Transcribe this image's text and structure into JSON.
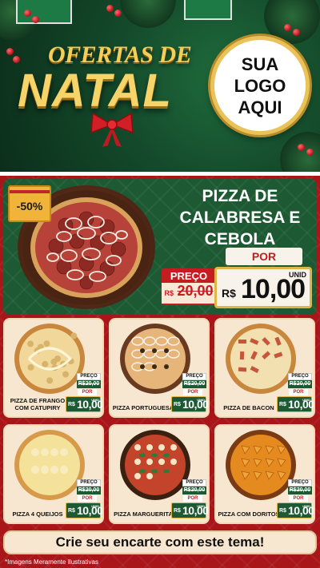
{
  "header": {
    "title_small": "OFERTAS DE",
    "title_big": "NATAL",
    "logo_lines": [
      "SUA",
      "LOGO",
      "AQUI"
    ]
  },
  "featured": {
    "discount": "-50%",
    "title_lines": [
      "PIZZA DE",
      "CALABRESA E",
      "CEBOLA"
    ],
    "preco_label": "PREÇO",
    "old_currency": "R$",
    "old_price": "20,00",
    "por_label": "POR",
    "unid_label": "UNID",
    "new_currency": "R$",
    "new_price": "10,00"
  },
  "products": [
    {
      "name": "PIZZA DE FRANGO COM CATUPIRY",
      "preco_label": "PREÇO",
      "old_currency": "R$",
      "old_price": "20,00",
      "por_label": "POR",
      "currency": "R$",
      "price": "10,00",
      "unid": "UNID",
      "topping": "frango"
    },
    {
      "name": "PIZZA PORTUGUESA",
      "preco_label": "PREÇO",
      "old_currency": "R$",
      "old_price": "20,00",
      "por_label": "POR",
      "currency": "R$",
      "price": "10,00",
      "unid": "UNID",
      "topping": "portuguesa"
    },
    {
      "name": "PIZZA DE BACON",
      "preco_label": "PREÇO",
      "old_currency": "R$",
      "old_price": "20,00",
      "por_label": "POR",
      "currency": "R$",
      "price": "10,00",
      "unid": "UNID",
      "topping": "bacon"
    },
    {
      "name": "PIZZA 4 QUEIJOS",
      "preco_label": "PREÇO",
      "old_currency": "R$",
      "old_price": "20,00",
      "por_label": "POR",
      "currency": "R$",
      "price": "10,00",
      "unid": "UNID",
      "topping": "queijos"
    },
    {
      "name": "PIZZA MARGUERITA",
      "preco_label": "PREÇO",
      "old_currency": "R$",
      "old_price": "20,00",
      "por_label": "POR",
      "currency": "R$",
      "price": "10,00",
      "unid": "UNID",
      "topping": "marguerita"
    },
    {
      "name": "PIZZA COM DORITOS",
      "preco_label": "PREÇO",
      "old_currency": "R$",
      "old_price": "20,00",
      "por_label": "POR",
      "currency": "R$",
      "price": "10,00",
      "unid": "UNID",
      "topping": "doritos"
    }
  ],
  "cta": "Crie seu encarte com este tema!",
  "footnote": "*Imagens Meramente Ilustrativas",
  "colors": {
    "green": "#1d5a33",
    "red": "#a8161a",
    "gold": "#e0b548",
    "cream": "#f7e7d1"
  }
}
